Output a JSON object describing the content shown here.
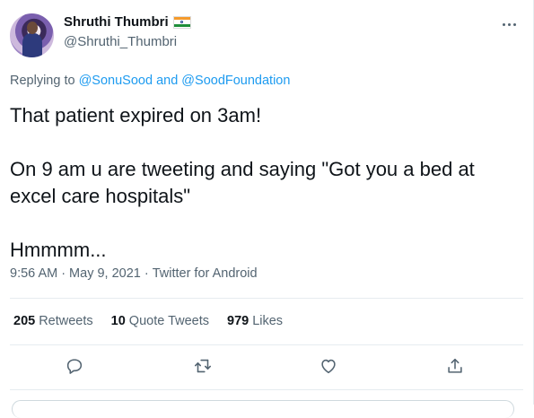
{
  "user": {
    "display_name": "Shruthi Thumbri",
    "handle": "@Shruthi_Thumbri",
    "flag_icon": "india-flag-icon"
  },
  "reply": {
    "prefix": "Replying to",
    "mention_1": "@SonuSood",
    "conjunction": "and",
    "mention_2": "@SoodFoundation"
  },
  "tweet": {
    "line_1": "That patient expired on 3am!",
    "line_2": "On 9 am u are tweeting and saying \"Got you a bed at",
    "line_3": "excel care hospitals\"",
    "line_4": "Hmmmm..."
  },
  "meta": {
    "time": "9:56 AM",
    "date": "May 9, 2021",
    "source": "Twitter for Android",
    "separator": "·"
  },
  "stats": {
    "retweets_count": "205",
    "retweets_label": "Retweets",
    "quotes_count": "10",
    "quotes_label": "Quote Tweets",
    "likes_count": "979",
    "likes_label": "Likes"
  },
  "icons": {
    "reply": "reply-icon",
    "retweet": "retweet-icon",
    "like": "heart-icon",
    "share": "share-icon",
    "more": "more-icon"
  },
  "colors": {
    "link": "#1d9bf0",
    "secondary_text": "#536471",
    "primary_text": "#0f1419"
  }
}
